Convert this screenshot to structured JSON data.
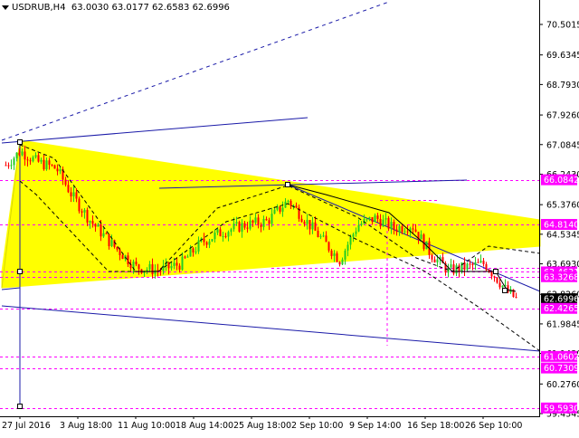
{
  "header": {
    "symbol": "USDRUB,H4",
    "open": "63.0030",
    "high": "63.0177",
    "low": "62.6583",
    "close": "62.6996"
  },
  "y_axis": {
    "min": 59.4345,
    "max": 71.0,
    "ticks": [
      "70.5015",
      "69.6345",
      "68.7930",
      "67.9260",
      "67.0845",
      "66.2430",
      "65.3760",
      "64.5345",
      "63.6930",
      "62.8260",
      "61.9845",
      "61.1430",
      "60.2760",
      "59.4345"
    ]
  },
  "x_axis": {
    "labels": [
      "27 Jul 2016",
      "3 Aug 18:00",
      "11 Aug 10:00",
      "18 Aug 14:00",
      "25 Aug 18:00",
      "2 Sep 10:00",
      "9 Sep 14:00",
      "16 Sep 18:00",
      "26 Sep 10:00"
    ]
  },
  "price_labels": [
    {
      "text": "66.0842",
      "value": 66.0842,
      "color": "#ff00ff"
    },
    {
      "text": "64.8140",
      "value": 64.814,
      "color": "#ff00ff"
    },
    {
      "text": "63.4631",
      "value": 63.4631,
      "color": "#ff00ff"
    },
    {
      "text": "63.3268",
      "value": 63.3268,
      "color": "#ff00ff"
    },
    {
      "text": "62.6996",
      "value": 62.6996,
      "color": "#000000"
    },
    {
      "text": "62.4265",
      "value": 62.4265,
      "color": "#ff00ff"
    },
    {
      "text": "61.0602",
      "value": 61.0602,
      "color": "#ff00ff"
    },
    {
      "text": "60.7309",
      "value": 60.7309,
      "color": "#ff00ff"
    },
    {
      "text": "59.5930",
      "value": 59.593,
      "color": "#ff00ff"
    }
  ],
  "colors": {
    "background": "#ffffff",
    "triangle_fill": "#ffff00",
    "bull_candle": "#22cc22",
    "bear_candle": "#ff0000",
    "trend_line": "#1a1aa8",
    "level_line": "#ff00ff",
    "wave_line": "#000000"
  },
  "chart_data": {
    "type": "candlestick",
    "symbol": "USDRUB",
    "timeframe": "H4",
    "ylim": [
      59.4345,
      71.0
    ],
    "close_path": [
      [
        "27 Jul 2016",
        66.5
      ],
      [
        "29 Jul",
        66.9
      ],
      [
        "1 Aug",
        66.6
      ],
      [
        "3 Aug 18:00",
        66.3
      ],
      [
        "5 Aug",
        65.8
      ],
      [
        "8 Aug",
        64.9
      ],
      [
        "9 Aug",
        64.6
      ],
      [
        "11 Aug 10:00",
        64.0
      ],
      [
        "15 Aug",
        63.5
      ],
      [
        "16 Aug",
        63.6
      ],
      [
        "18 Aug 14:00",
        64.0
      ],
      [
        "21 Aug",
        64.6
      ],
      [
        "23 Aug",
        64.8
      ],
      [
        "25 Aug 18:00",
        64.9
      ],
      [
        "28 Aug",
        65.2
      ],
      [
        "31 Aug",
        65.5
      ],
      [
        "2 Sep 10:00",
        65.0
      ],
      [
        "5 Sep",
        64.6
      ],
      [
        "7 Sep",
        64.2
      ],
      [
        "9 Sep 14:00",
        64.8
      ],
      [
        "12 Sep",
        65.0
      ],
      [
        "14 Sep",
        64.9
      ],
      [
        "16 Sep 18:00",
        64.0
      ],
      [
        "20 Sep",
        63.6
      ],
      [
        "23 Sep",
        63.9
      ],
      [
        "26 Sep 10:00",
        63.6
      ],
      [
        "28 Sep",
        63.0
      ],
      [
        "29 Sep",
        62.7
      ]
    ],
    "levels": [
      66.0842,
      64.814,
      63.4631,
      63.3268,
      62.4265,
      61.0602,
      60.7309,
      59.593
    ]
  }
}
